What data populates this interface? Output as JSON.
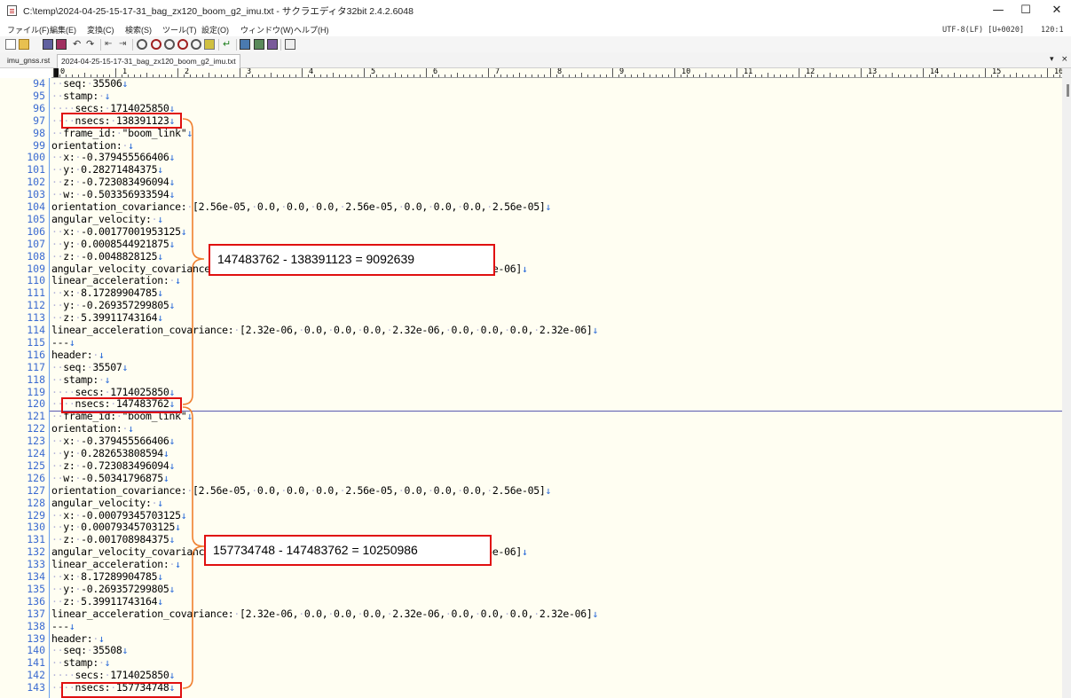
{
  "window": {
    "title": "C:\\temp\\2024-04-25-15-17-31_bag_zx120_boom_g2_imu.txt - サクラエディタ32bit 2.4.2.6048",
    "controls": {
      "minimize": "—",
      "maximize": "☐",
      "close": "✕"
    }
  },
  "menu": {
    "items": [
      "ファイル(F)",
      "編集(E)",
      "変換(C)",
      "検索(S)",
      "ツール(T)",
      "設定(O)",
      "ウィンドウ(W)",
      "ヘルプ(H)"
    ],
    "encoding": "UTF-8(LF) [U+0020]",
    "position": "120:1"
  },
  "toolbar": {
    "icons": [
      "new-file",
      "open-file",
      "save",
      "save-all",
      "undo",
      "redo",
      "prev-change",
      "next-change",
      "search-previous",
      "search-next",
      "search",
      "grep",
      "replace",
      "mark",
      "jump",
      "outline",
      "find-bracket",
      "compare",
      "print"
    ]
  },
  "tabs": {
    "items": [
      {
        "label": "imu_gnss.rst",
        "active": false
      },
      {
        "label": "2024-04-25-15-17-31_bag_zx120_boom_g2_imu.txt",
        "active": true
      }
    ],
    "dropdown": "▾",
    "close": "×"
  },
  "ruler": {
    "labels": [
      "0",
      "1",
      "2",
      "3",
      "4",
      "5",
      "6",
      "7",
      "8",
      "9",
      "10",
      "11",
      "12",
      "13",
      "14",
      "15",
      "16"
    ]
  },
  "editor": {
    "lines": [
      {
        "n": "94",
        "t": "··seq:·35506↓"
      },
      {
        "n": "95",
        "t": "··stamp:·↓"
      },
      {
        "n": "96",
        "t": "····secs:·1714025850↓"
      },
      {
        "n": "97",
        "t": "····nsecs:·138391123↓"
      },
      {
        "n": "98",
        "t": "··frame_id:·\"boom_link\"↓"
      },
      {
        "n": "99",
        "t": "orientation:·↓"
      },
      {
        "n": "100",
        "t": "··x:·-0.379455566406↓"
      },
      {
        "n": "101",
        "t": "··y:·0.28271484375↓"
      },
      {
        "n": "102",
        "t": "··z:·-0.723083496094↓"
      },
      {
        "n": "103",
        "t": "··w:·-0.503356933594↓"
      },
      {
        "n": "104",
        "t": "orientation_covariance:·[2.56e-05,·0.0,·0.0,·0.0,·2.56e-05,·0.0,·0.0,·0.0,·2.56e-05]↓"
      },
      {
        "n": "105",
        "t": "angular_velocity:·↓"
      },
      {
        "n": "106",
        "t": "··x:·-0.00177001953125↓"
      },
      {
        "n": "107",
        "t": "··y:·0.0008544921875↓"
      },
      {
        "n": "108",
        "t": "··z:·-0.0048828125↓"
      },
      {
        "n": "109",
        "t": "angular_velocity_covariance:·[5e-06,·0.0,·0.0,·0.0,·5e-06,·0.0,·0.0,·0.0,·5e-06]↓"
      },
      {
        "n": "110",
        "t": "linear_acceleration:·↓"
      },
      {
        "n": "111",
        "t": "··x:·8.17289904785↓"
      },
      {
        "n": "112",
        "t": "··y:·-0.269357299805↓"
      },
      {
        "n": "113",
        "t": "··z:·5.39911743164↓"
      },
      {
        "n": "114",
        "t": "linear_acceleration_covariance:·[2.32e-06,·0.0,·0.0,·0.0,·2.32e-06,·0.0,·0.0,·0.0,·2.32e-06]↓"
      },
      {
        "n": "115",
        "t": "---↓"
      },
      {
        "n": "116",
        "t": "header:·↓"
      },
      {
        "n": "117",
        "t": "··seq:·35507↓"
      },
      {
        "n": "118",
        "t": "··stamp:·↓"
      },
      {
        "n": "119",
        "t": "····secs:·1714025850↓"
      },
      {
        "n": "120",
        "t": "····nsecs:·147483762↓"
      },
      {
        "n": "121",
        "t": "··frame_id:·\"boom_link\"↓"
      },
      {
        "n": "122",
        "t": "orientation:·↓"
      },
      {
        "n": "123",
        "t": "··x:·-0.379455566406↓"
      },
      {
        "n": "124",
        "t": "··y:·0.282653808594↓"
      },
      {
        "n": "125",
        "t": "··z:·-0.723083496094↓"
      },
      {
        "n": "126",
        "t": "··w:·-0.50341796875↓"
      },
      {
        "n": "127",
        "t": "orientation_covariance:·[2.56e-05,·0.0,·0.0,·0.0,·2.56e-05,·0.0,·0.0,·0.0,·2.56e-05]↓"
      },
      {
        "n": "128",
        "t": "angular_velocity:·↓"
      },
      {
        "n": "129",
        "t": "··x:·-0.00079345703125↓"
      },
      {
        "n": "130",
        "t": "··y:·0.00079345703125↓"
      },
      {
        "n": "131",
        "t": "··z:·-0.001708984375↓"
      },
      {
        "n": "132",
        "t": "angular_velocity_covariance:·[5e-06,·0.0,·0.0,·0.0,·5e-06,·0.0,·0.0,·0.0,·5e-06]↓"
      },
      {
        "n": "133",
        "t": "linear_acceleration:·↓"
      },
      {
        "n": "134",
        "t": "··x:·8.17289904785↓"
      },
      {
        "n": "135",
        "t": "··y:·-0.269357299805↓"
      },
      {
        "n": "136",
        "t": "··z:·5.39911743164↓"
      },
      {
        "n": "137",
        "t": "linear_acceleration_covariance:·[2.32e-06,·0.0,·0.0,·0.0,·2.32e-06,·0.0,·0.0,·0.0,·2.32e-06]↓"
      },
      {
        "n": "138",
        "t": "---↓"
      },
      {
        "n": "139",
        "t": "header:·↓"
      },
      {
        "n": "140",
        "t": "··seq:·35508↓"
      },
      {
        "n": "141",
        "t": "··stamp:·↓"
      },
      {
        "n": "142",
        "t": "····secs:·1714025850↓"
      },
      {
        "n": "143",
        "t": "····nsecs:·157734748↓"
      }
    ],
    "current_line": "120"
  },
  "annotations": {
    "diff1": "147483762 - 138391123 = 9092639",
    "diff2": "157734748 - 147483762  = 10250986"
  },
  "colors": {
    "highlight": "#e01010",
    "bracket": "#f08030",
    "line_numbers": "#3a6ad0",
    "editor_bg": "#fffef2"
  }
}
